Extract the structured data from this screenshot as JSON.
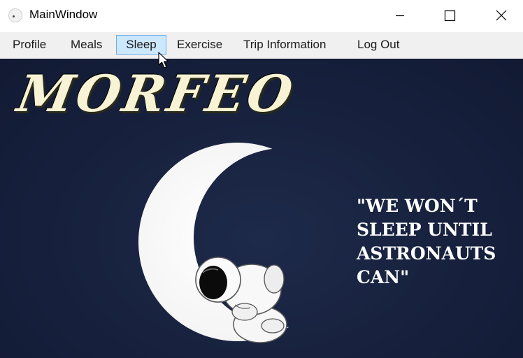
{
  "window": {
    "title": "MainWindow"
  },
  "menu": {
    "items": [
      {
        "label": "Profile"
      },
      {
        "label": "Meals"
      },
      {
        "label": "Sleep"
      },
      {
        "label": "Exercise"
      },
      {
        "label": "Trip Information"
      },
      {
        "label": "Log Out"
      }
    ],
    "active": "Sleep"
  },
  "content": {
    "logo": "MORFEO",
    "slogan": "\"WE WON´T\nSLEEP UNTIL\nASTRONAUTS\nCAN\""
  },
  "colors": {
    "background": "#16203c",
    "menu_active_bg": "#cce8ff",
    "menu_active_border": "#6aaee6",
    "logo_text": "#f8f3d4"
  },
  "icons": [
    "app-icon",
    "minimize-icon",
    "maximize-icon",
    "close-icon",
    "mouse-cursor-icon",
    "moon-illustration",
    "astronaut-illustration"
  ]
}
